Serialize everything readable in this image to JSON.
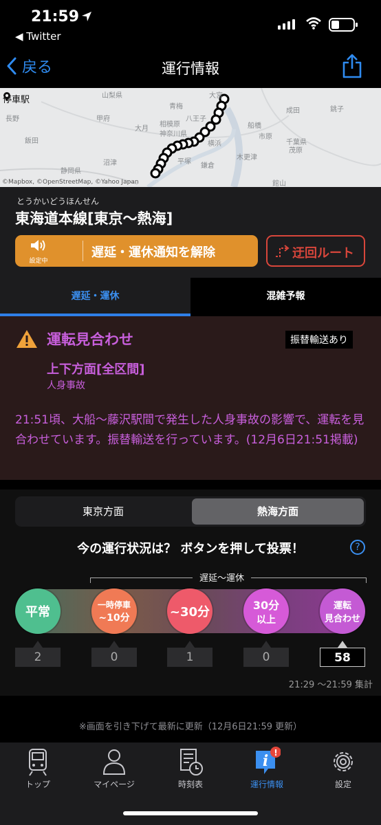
{
  "status_bar": {
    "time": "21:59",
    "back_app": "◀ Twitter"
  },
  "nav": {
    "back_label": "戻る",
    "title": "運行情報"
  },
  "map": {
    "chip_label": "停車駅",
    "place_labels": [
      "山梨県",
      "大月",
      "甲府",
      "相模原",
      "神奈川県",
      "横浜",
      "大宮",
      "青梅",
      "八王子",
      "千葉県",
      "船橋",
      "成田",
      "銚子",
      "茂原",
      "木更津",
      "静岡県",
      "飯田",
      "沼津",
      "平塚",
      "鎌倉",
      "長野",
      "館山",
      "市原"
    ],
    "attribution": "©Mapbox, ©OpenStreetMap, ©Yahoo Japan"
  },
  "line": {
    "ruby": "とうかいどうほんせん",
    "name": "東海道本線[東京〜熱海]",
    "notify_state": "設定中",
    "notify_label": "遅延・運休通知を解除",
    "detour_label": "迂回ルート"
  },
  "tabs": [
    {
      "label": "遅延・運休"
    },
    {
      "label": "混雑予報"
    }
  ],
  "alert": {
    "status": "運転見合わせ",
    "badge": "振替輸送あり",
    "section": "上下方面[全区間]",
    "cause": "人身事故",
    "message": "21:51頃、大船〜藤沢駅間で発生した人身事故の影響で、運転を見合わせています。振替輸送を行っています。(12月6日21:51掲載)"
  },
  "vote": {
    "directions": [
      "東京方面",
      "熱海方面"
    ],
    "selected_direction": "熱海方面",
    "question": "今の運行状況は？ ボタンを押して投票！",
    "help": "?",
    "bracket_label": "遅延〜運休",
    "options": [
      {
        "line1": "平常",
        "line2": "",
        "count": "2",
        "color": "#4fbf8f"
      },
      {
        "line1": "一時停車",
        "line2": "~10分",
        "count": "0",
        "color": "#f07a55"
      },
      {
        "line1": "~30分",
        "line2": "",
        "count": "1",
        "color": "#ee5a6a"
      },
      {
        "line1": "30分",
        "line2": "以上",
        "count": "0",
        "color": "#d65ad8"
      },
      {
        "line1": "運転",
        "line2": "見合わせ",
        "count": "58",
        "color": "#c45ad4"
      }
    ],
    "tally": "21:29 〜21:59 集計"
  },
  "refresh_note": "※画面を引き下げて最新に更新（12月6日21:59 更新）",
  "tabbar": [
    {
      "label": "トップ",
      "icon": "train-icon"
    },
    {
      "label": "マイページ",
      "icon": "person-icon"
    },
    {
      "label": "時刻表",
      "icon": "timetable-icon"
    },
    {
      "label": "運行情報",
      "icon": "info-icon",
      "badge": "!"
    },
    {
      "label": "設定",
      "icon": "gear-icon"
    }
  ],
  "colors": {
    "accent_blue": "#3b8ff0",
    "alert_purple": "#c85fdc",
    "notify_orange": "#e0912c",
    "detour_red": "#d9463b"
  }
}
